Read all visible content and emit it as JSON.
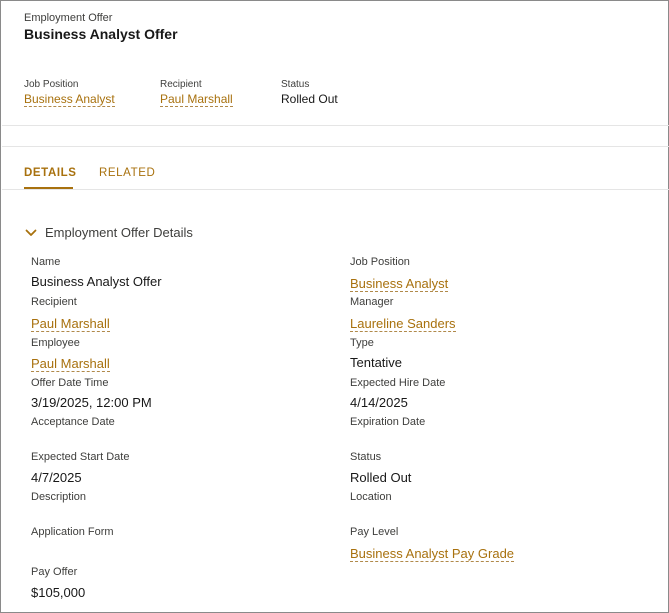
{
  "header": {
    "object_label": "Employment Offer",
    "title": "Business Analyst Offer"
  },
  "highlights": [
    {
      "label": "Job Position",
      "value": "Business Analyst",
      "link": true
    },
    {
      "label": "Recipient",
      "value": "Paul Marshall",
      "link": true
    },
    {
      "label": "Status",
      "value": "Rolled Out",
      "link": false
    }
  ],
  "tabs": [
    {
      "label": "DETAILS",
      "active": true
    },
    {
      "label": "RELATED",
      "active": false
    }
  ],
  "section": {
    "title": "Employment Offer Details",
    "expanded": true
  },
  "fields": {
    "left": [
      {
        "label": "Name",
        "value": "Business Analyst Offer",
        "link": false
      },
      {
        "label": "Recipient",
        "value": "Paul Marshall",
        "link": true
      },
      {
        "label": "Employee",
        "value": "Paul Marshall",
        "link": true
      },
      {
        "label": "Offer Date Time",
        "value": "3/19/2025, 12:00 PM",
        "link": false
      },
      {
        "label": "Acceptance Date",
        "value": "",
        "link": false
      },
      {
        "label": "Expected Start Date",
        "value": "4/7/2025",
        "link": false
      },
      {
        "label": "Description",
        "value": "",
        "link": false
      },
      {
        "label": "Application Form",
        "value": "",
        "link": false
      },
      {
        "label": "Pay Offer",
        "value": "$105,000",
        "link": false
      }
    ],
    "right": [
      {
        "label": "Job Position",
        "value": "Business Analyst",
        "link": true
      },
      {
        "label": "Manager",
        "value": "Laureline Sanders",
        "link": true
      },
      {
        "label": "Type",
        "value": "Tentative",
        "link": false
      },
      {
        "label": "Expected Hire Date",
        "value": "4/14/2025",
        "link": false
      },
      {
        "label": "Expiration Date",
        "value": "",
        "link": false
      },
      {
        "label": "Status",
        "value": "Rolled Out",
        "link": false
      },
      {
        "label": "Location",
        "value": "",
        "link": false
      },
      {
        "label": "Pay Level",
        "value": "Business Analyst Pay Grade",
        "link": true
      }
    ]
  },
  "colors": {
    "accent": "#a8710e",
    "text": "#181818",
    "label": "#3e3e3c",
    "divider": "#e5e5e5"
  },
  "icons": {
    "section_toggle": "chevron-down-icon"
  }
}
